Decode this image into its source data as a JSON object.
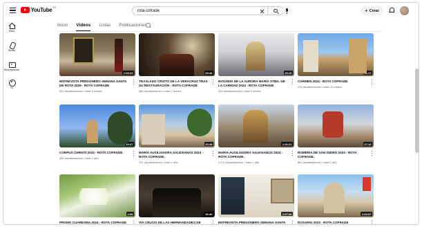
{
  "header": {
    "logo_text": "YouTube",
    "logo_country": "ES",
    "search_value": "rota cofrade",
    "create_label": "Crear"
  },
  "sidebar": {
    "items": [
      {
        "label": "Inicio",
        "icon": "home-icon"
      },
      {
        "label": "Shorts",
        "icon": "shorts-icon"
      },
      {
        "label": "Suscripciones",
        "icon": "subscriptions-icon"
      },
      {
        "label": "Tú",
        "icon": "you-icon"
      }
    ]
  },
  "tabs": [
    {
      "label": "Inicio",
      "active": false
    },
    {
      "label": "Videos",
      "active": true
    },
    {
      "label": "Listas",
      "active": false
    },
    {
      "label": "Publicaciones",
      "active": false
    }
  ],
  "videos": [
    {
      "title": "ENTREVISTA PREGONERO SEMANA SANTA DE ROTA 2025 - ROTA COFRADE",
      "duration": "1:05:23",
      "views": "321 visualizaciones",
      "age": "hace 3 meses"
    },
    {
      "title": "TRASLADO CRISTO DE LA VERACRUZ TRAS SU RESTAURACIÓN - ROTA COFRADE",
      "duration": "25:46",
      "views": "366 visualizaciones",
      "age": "hace 7 meses"
    },
    {
      "title": "ROSARIO DE LA AURORA MARÍA STMA. DE LA CARIDAD 2024 - ROTA COFRADE",
      "duration": "28:10",
      "views": "318 visualizaciones",
      "age": "hace 9 meses"
    },
    {
      "title": "CARMEN 2024 - ROTA COFRADE.",
      "duration": "51:17",
      "views": "419 visualizaciones",
      "age": "hace 10 meses"
    },
    {
      "title": "CORPUS CHRISTI 2024 - ROTA COFRADE.",
      "duration": "29:47",
      "views": "450 visualizaciones",
      "age": "hace 1 año"
    },
    {
      "title": "MARÍA AUXILIADORA SALESIANAS 2024 - ROTA COFRADE.",
      "duration": "20:48",
      "views": "701 visualizaciones",
      "age": "hace 1 año"
    },
    {
      "title": "MARÍA AUXILIADORA SALESIANOS 2024 - ROTA COFRADE.",
      "duration": "1:26:21",
      "views": "1,3 K visualizaciones",
      "age": "hace 1 año"
    },
    {
      "title": "ROMERÍA DE SAN ISIDRO 2024 - ROTA COFRADE.",
      "duration": "37:16",
      "views": "861 visualizaciones",
      "age": "hace 1 año"
    },
    {
      "title": "PROMO CUARESMA 2024 - ROTA COFRADE",
      "duration": "4:08",
      "views": "",
      "age": ""
    },
    {
      "title": "VÍA CRUCIS DE LAS HERMANDADES DE",
      "duration": "36:40",
      "views": "",
      "age": ""
    },
    {
      "title": "ENTREVISTA PREGONERO SEMANA SANTA",
      "duration": "1:07:06",
      "views": "",
      "age": ""
    },
    {
      "title": "ROSARIO 2023 - ROTA COFRADE",
      "duration": "1:34:57",
      "views": "",
      "age": ""
    }
  ]
}
